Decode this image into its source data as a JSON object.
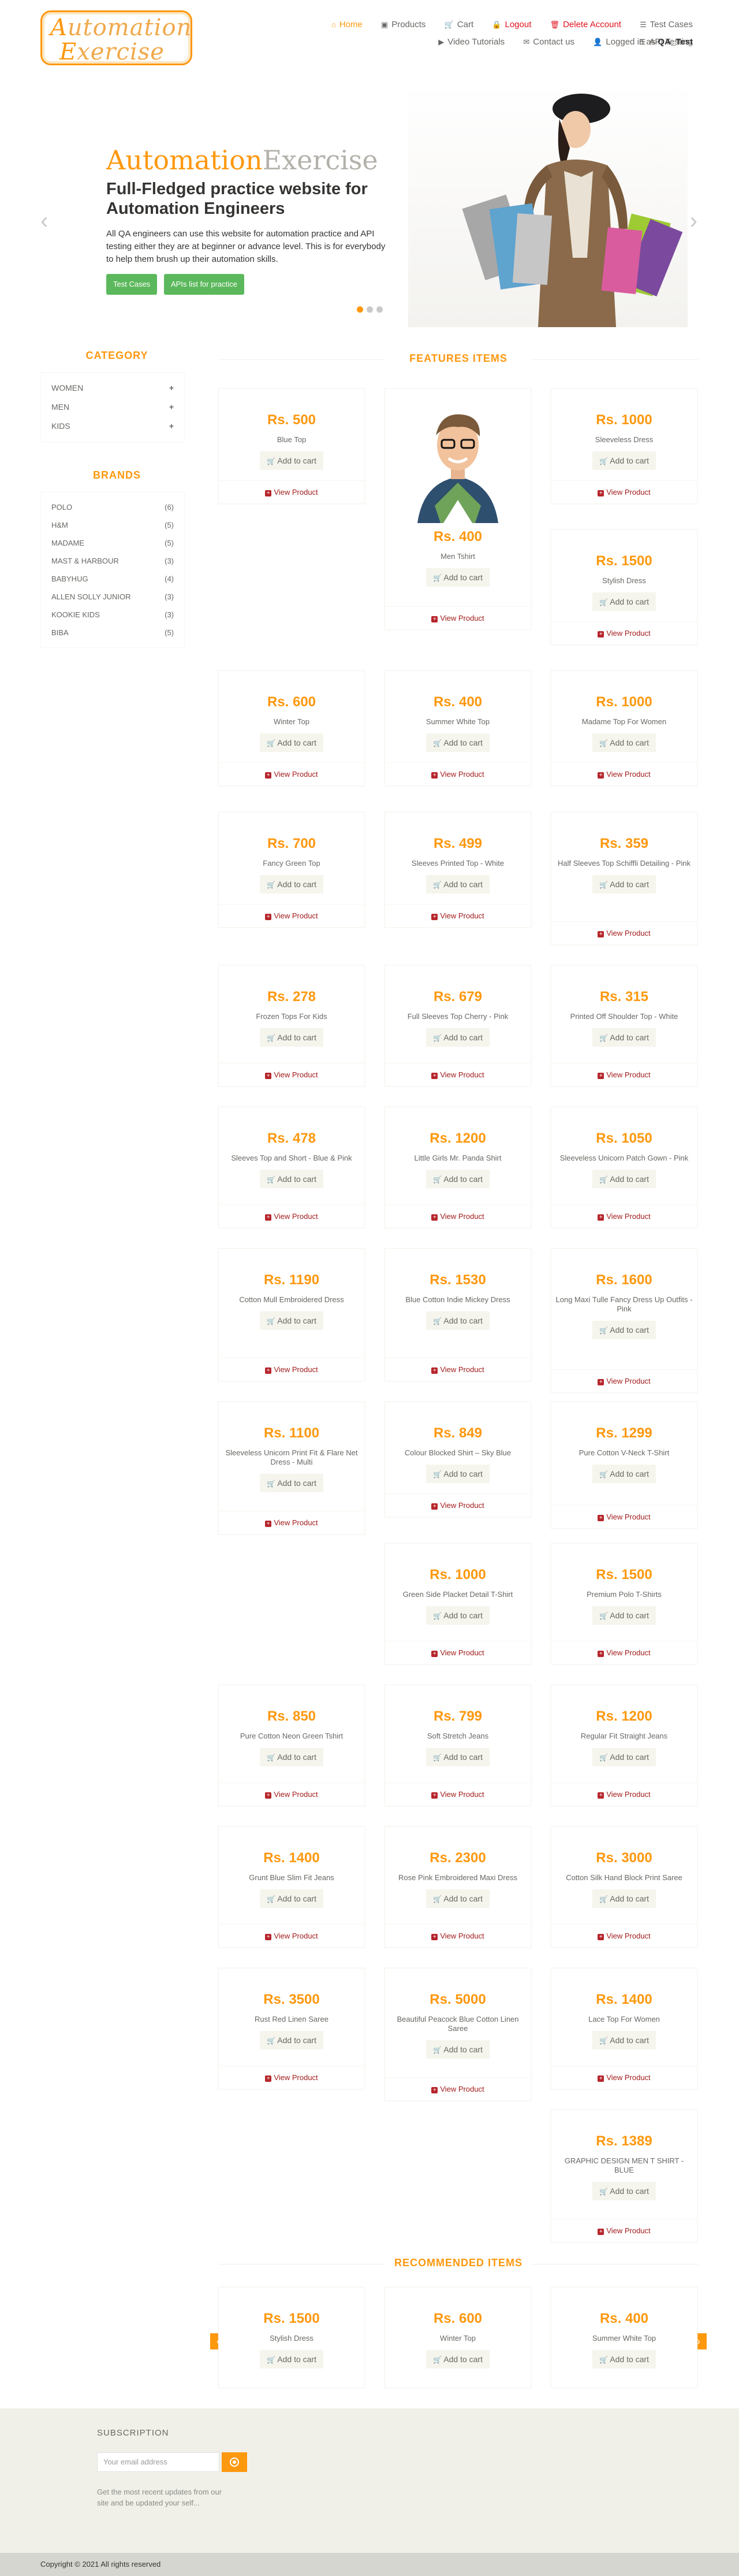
{
  "header": {
    "logo_a": "A",
    "logo_a_rest": "utomation",
    "logo_e": "E",
    "logo_e_rest": "xercise",
    "nav": {
      "home": "Home",
      "products": "Products",
      "cart": "Cart",
      "logout": "Logout",
      "delete": "Delete Account",
      "test_cases": "Test Cases",
      "api_testing": "API Testing",
      "video": "Video Tutorials",
      "contact": "Contact us",
      "logged_prefix": "Logged in as",
      "logged_user": "QA_Test"
    }
  },
  "slider": {
    "brand_first": "Automation",
    "brand_second": "Exercise",
    "heading": "Full-Fledged practice website for Automation Engineers",
    "text": "All QA engineers can use this website for automation practice and API testing either they are at beginner or advance level. This is for everybody to help them brush up their automation skills.",
    "btn_test_cases": "Test Cases",
    "btn_apis": "APIs list for practice"
  },
  "sidebar": {
    "category_title": "CATEGORY",
    "categories": [
      "Women",
      "Men",
      "Kids"
    ],
    "brands_title": "BRANDS",
    "brands": [
      {
        "name": "Polo",
        "count": "(6)"
      },
      {
        "name": "H&M",
        "count": "(5)"
      },
      {
        "name": "Madame",
        "count": "(5)"
      },
      {
        "name": "Mast & Harbour",
        "count": "(3)"
      },
      {
        "name": "Babyhug",
        "count": "(4)"
      },
      {
        "name": "Allen Solly Junior",
        "count": "(3)"
      },
      {
        "name": "Kookie Kids",
        "count": "(3)"
      },
      {
        "name": "Biba",
        "count": "(5)"
      }
    ]
  },
  "features_title": "FEATURES ITEMS",
  "add_label": "Add to cart",
  "view_label": "View Product",
  "products": [
    {
      "price": "Rs. 500",
      "name": "Blue Top"
    },
    {
      "price": "Rs. 400",
      "name": "Men Tshirt"
    },
    {
      "price": "Rs. 1000",
      "name": "Sleeveless Dress"
    },
    {
      "price": "Rs. 1500",
      "name": "Stylish Dress"
    },
    {
      "price": "Rs. 600",
      "name": "Winter Top"
    },
    {
      "price": "Rs. 400",
      "name": "Summer White Top"
    },
    {
      "price": "Rs. 1000",
      "name": "Madame Top For Women"
    },
    {
      "price": "Rs. 700",
      "name": "Fancy Green Top"
    },
    {
      "price": "Rs. 499",
      "name": "Sleeves Printed Top - White"
    },
    {
      "price": "Rs. 359",
      "name": "Half Sleeves Top Schiffli Detailing - Pink"
    },
    {
      "price": "Rs. 278",
      "name": "Frozen Tops For Kids"
    },
    {
      "price": "Rs. 679",
      "name": "Full Sleeves Top Cherry - Pink"
    },
    {
      "price": "Rs. 315",
      "name": "Printed Off Shoulder Top - White"
    },
    {
      "price": "Rs. 478",
      "name": "Sleeves Top and Short - Blue & Pink"
    },
    {
      "price": "Rs. 1200",
      "name": "Little Girls Mr. Panda Shirt"
    },
    {
      "price": "Rs. 1050",
      "name": "Sleeveless Unicorn Patch Gown - Pink"
    },
    {
      "price": "Rs. 1190",
      "name": "Cotton Mull Embroidered Dress"
    },
    {
      "price": "Rs. 1530",
      "name": "Blue Cotton Indie Mickey Dress"
    },
    {
      "price": "Rs. 1600",
      "name": "Long Maxi Tulle Fancy Dress Up Outfits -Pink"
    },
    {
      "price": "Rs. 1100",
      "name": "Sleeveless Unicorn Print Fit & Flare Net Dress - Multi"
    },
    {
      "price": "Rs. 849",
      "name": "Colour Blocked Shirt – Sky Blue"
    },
    {
      "price": "Rs. 1299",
      "name": "Pure Cotton V-Neck T-Shirt"
    },
    {
      "price": "Rs. 1000",
      "name": "Green Side Placket Detail T-Shirt"
    },
    {
      "price": "Rs. 1500",
      "name": "Premium Polo T-Shirts"
    },
    {
      "price": "Rs. 850",
      "name": "Pure Cotton Neon Green Tshirt"
    },
    {
      "price": "Rs. 799",
      "name": "Soft Stretch Jeans"
    },
    {
      "price": "Rs. 1200",
      "name": "Regular Fit Straight Jeans"
    },
    {
      "price": "Rs. 1400",
      "name": "Grunt Blue Slim Fit Jeans"
    },
    {
      "price": "Rs. 2300",
      "name": "Rose Pink Embroidered Maxi Dress"
    },
    {
      "price": "Rs. 3000",
      "name": "Cotton Silk Hand Block Print Saree"
    },
    {
      "price": "Rs. 3500",
      "name": "Rust Red Linen Saree"
    },
    {
      "price": "Rs. 5000",
      "name": "Beautiful Peacock Blue Cotton Linen Saree"
    },
    {
      "price": "Rs. 1400",
      "name": "Lace Top For Women"
    },
    {
      "price": "Rs. 1389",
      "name": "GRAPHIC DESIGN MEN T SHIRT - BLUE"
    }
  ],
  "recommended_title": "RECOMMENDED ITEMS",
  "recommended": [
    {
      "price": "Rs. 1500",
      "name": "Stylish Dress"
    },
    {
      "price": "Rs. 600",
      "name": "Winter Top"
    },
    {
      "price": "Rs. 400",
      "name": "Summer White Top"
    }
  ],
  "footer": {
    "subscription": "SUBSCRIPTION",
    "placeholder": "Your email address",
    "text": "Get the most recent updates from our site and be updated your self...",
    "copyright": "Copyright © 2021 All rights reserved"
  },
  "colors": {
    "accent": "#fe980f",
    "button_green": "#5cb85c",
    "view_red": "#a21c1c"
  },
  "icons": [
    "home-icon",
    "products-icon",
    "cart-icon",
    "lock-icon",
    "trash-icon",
    "list-icon",
    "video-icon",
    "envelope-icon",
    "user-icon",
    "chevron-left-icon",
    "chevron-right-icon",
    "plus-icon",
    "plus-square-icon"
  ]
}
